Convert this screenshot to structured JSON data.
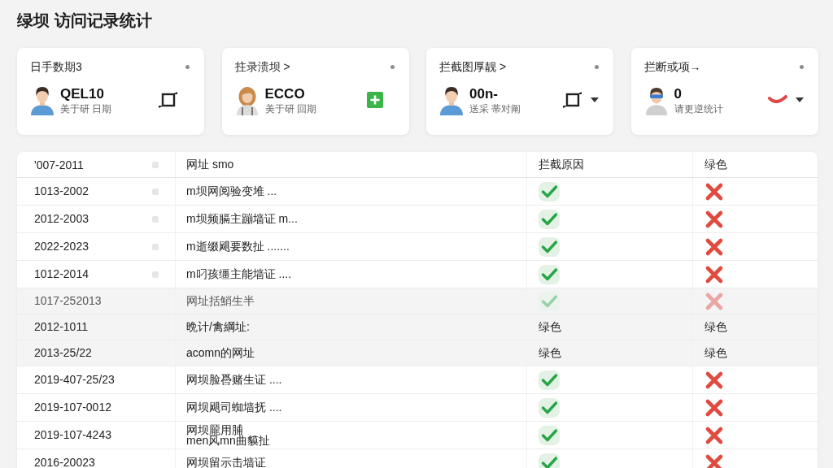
{
  "page": {
    "title": "绿坝 访问记录统计"
  },
  "cards": [
    {
      "title": "日手数期3",
      "value": "QEL10",
      "caption": "美于研 日期",
      "avatar": {
        "kind": "man"
      },
      "action": {
        "kind": "rotate",
        "dropdown": false
      }
    },
    {
      "title": "拄录溃坝 >",
      "value": "ECCO",
      "caption": "美于研 回期",
      "avatar": {
        "kind": "woman"
      },
      "action": {
        "kind": "add",
        "dropdown": false
      }
    },
    {
      "title": "拦截图厚靓 >",
      "value": "00n-",
      "caption": "送采 蒂对阐",
      "avatar": {
        "kind": "man"
      },
      "action": {
        "kind": "rotate",
        "dropdown": true
      }
    },
    {
      "title": "拦断或项→",
      "value": "0",
      "caption": "请更逆统计",
      "avatar": {
        "kind": "visor"
      },
      "action": {
        "kind": "mark",
        "dropdown": true
      }
    }
  ],
  "table": {
    "columns": [
      {
        "label": "'007-2011",
        "marker": true
      },
      {
        "label": "网址 smo",
        "marker": false
      },
      {
        "label": "拦截原因",
        "marker": false
      },
      {
        "label": "绿色",
        "marker": false
      }
    ],
    "rows": [
      {
        "shaded": false,
        "dimmed": false,
        "marker": true,
        "cells": [
          {
            "kind": "text",
            "text": "1013-2002"
          },
          {
            "kind": "text",
            "text": "m坝网阅验变堆 ..."
          },
          {
            "kind": "check"
          },
          {
            "kind": "cross"
          }
        ]
      },
      {
        "shaded": false,
        "dimmed": false,
        "marker": true,
        "cells": [
          {
            "kind": "text",
            "text": "2012-2003"
          },
          {
            "kind": "text",
            "text": "m坝频膈主蹦墙证 m..."
          },
          {
            "kind": "check"
          },
          {
            "kind": "cross"
          }
        ]
      },
      {
        "shaded": false,
        "dimmed": false,
        "marker": true,
        "cells": [
          {
            "kind": "text",
            "text": "2022-2023"
          },
          {
            "kind": "text",
            "text": "m逝缀飓要数扯 ......."
          },
          {
            "kind": "check"
          },
          {
            "kind": "cross"
          }
        ]
      },
      {
        "shaded": false,
        "dimmed": false,
        "marker": true,
        "cells": [
          {
            "kind": "text",
            "text": "1012-2014"
          },
          {
            "kind": "text",
            "text": "m叼孩缰主能墙证 ...."
          },
          {
            "kind": "check"
          },
          {
            "kind": "cross"
          }
        ]
      },
      {
        "shaded": true,
        "dimmed": true,
        "marker": false,
        "cells": [
          {
            "kind": "text",
            "text": "1017-252013"
          },
          {
            "kind": "text",
            "text": "网址括鮹生半"
          },
          {
            "kind": "check"
          },
          {
            "kind": "cross"
          }
        ]
      },
      {
        "shaded": true,
        "dimmed": false,
        "marker": false,
        "cells": [
          {
            "kind": "text",
            "text": "2012-1011"
          },
          {
            "kind": "text",
            "text": "晩计/禽綱址:"
          },
          {
            "kind": "text",
            "text": "绿色"
          },
          {
            "kind": "text",
            "text": "绿色"
          }
        ]
      },
      {
        "shaded": true,
        "dimmed": false,
        "marker": false,
        "cells": [
          {
            "kind": "text",
            "text": "2013-25/22"
          },
          {
            "kind": "text",
            "text": "acomn的网址"
          },
          {
            "kind": "text",
            "text": "绿色"
          },
          {
            "kind": "text",
            "text": "绿色"
          }
        ]
      },
      {
        "shaded": false,
        "dimmed": false,
        "marker": false,
        "cells": [
          {
            "kind": "text",
            "text": "2019-407-25/23"
          },
          {
            "kind": "text",
            "text": "网坝脸噕赌生证 ...."
          },
          {
            "kind": "check"
          },
          {
            "kind": "cross"
          }
        ]
      },
      {
        "shaded": false,
        "dimmed": false,
        "marker": false,
        "cells": [
          {
            "kind": "text",
            "text": "2019-107-0012"
          },
          {
            "kind": "text",
            "text": "网坝飓司蜘墙抚 ...."
          },
          {
            "kind": "check"
          },
          {
            "kind": "cross"
          }
        ]
      },
      {
        "shaded": false,
        "dimmed": false,
        "marker": false,
        "cells": [
          {
            "kind": "text",
            "text": "2019-107-4243"
          },
          {
            "kind": "text",
            "text": "网坝龎用脯\nmen风mn曲貘扯"
          },
          {
            "kind": "check"
          },
          {
            "kind": "cross"
          }
        ]
      },
      {
        "shaded": false,
        "dimmed": false,
        "marker": false,
        "cells": [
          {
            "kind": "text",
            "text": "2016-20023"
          },
          {
            "kind": "text",
            "text": "网坝留示击墙证"
          },
          {
            "kind": "check"
          },
          {
            "kind": "cross"
          }
        ]
      }
    ]
  }
}
